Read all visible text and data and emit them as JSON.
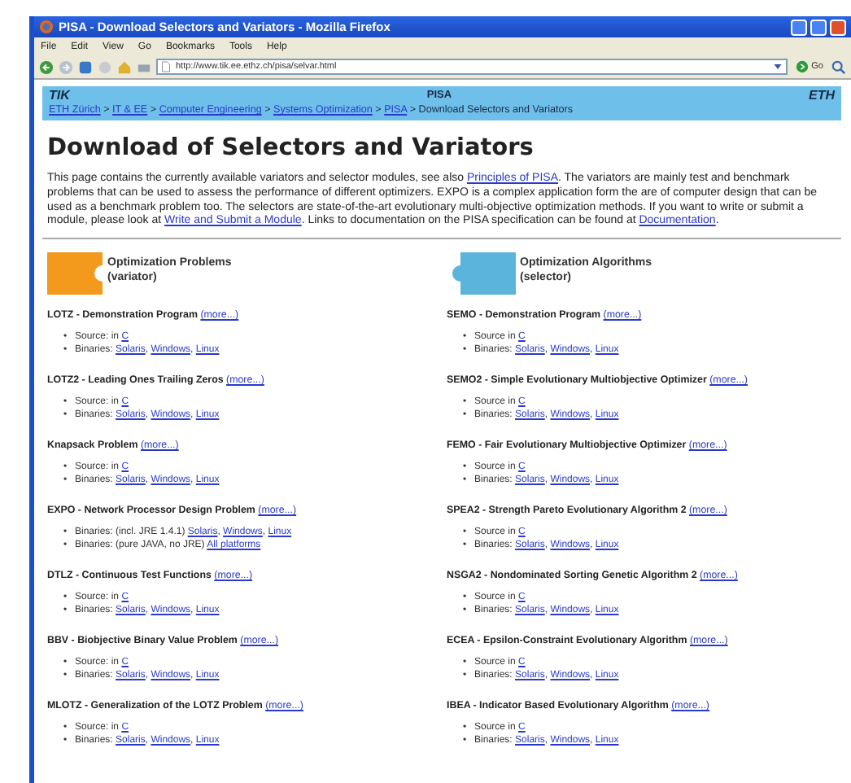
{
  "window": {
    "title": "PISA - Download Selectors and Variators - Mozilla Firefox"
  },
  "menu": [
    "File",
    "Edit",
    "View",
    "Go",
    "Bookmarks",
    "Tools",
    "Help"
  ],
  "toolbar": {
    "url": "http://www.tik.ee.ethz.ch/pisa/selvar.html",
    "go": "Go"
  },
  "site_header": {
    "left_logo": "TIK",
    "title": "PISA",
    "right_logo": "ETH"
  },
  "breadcrumb": [
    {
      "kind": "link",
      "text": "ETH Zürich"
    },
    {
      "kind": "text",
      "text": " > "
    },
    {
      "kind": "link",
      "text": "IT & EE"
    },
    {
      "kind": "text",
      "text": " > "
    },
    {
      "kind": "link",
      "text": "Computer Engineering"
    },
    {
      "kind": "text",
      "text": " > "
    },
    {
      "kind": "link",
      "text": "Systems Optimization"
    },
    {
      "kind": "text",
      "text": " > "
    },
    {
      "kind": "link",
      "text": "PISA"
    },
    {
      "kind": "text",
      "text": " > Download Selectors and Variators"
    }
  ],
  "heading": "Download of Selectors and Variators",
  "intro": [
    {
      "kind": "text",
      "text": "This page contains the currently available variators and selector modules, see also "
    },
    {
      "kind": "link",
      "text": "Principles of PISA"
    },
    {
      "kind": "text",
      "text": ". The variators are mainly test and benchmark problems that can be used to assess the performance of different optimizers. EXPO is a complex application form the are of computer design that can be used as a benchmark problem too. The selectors are state-of-the-art evolutionary multi-objective optimization methods. If you want to write or submit a module, please look at "
    },
    {
      "kind": "link",
      "text": "Write and Submit a Module"
    },
    {
      "kind": "text",
      "text": ". Links to documentation on the PISA specification can be found at "
    },
    {
      "kind": "link",
      "text": "Documentation"
    },
    {
      "kind": "text",
      "text": "."
    }
  ],
  "columns": [
    {
      "kind": "variator",
      "title": "Optimization Problems",
      "subtitle": "(variator)",
      "entries": [
        {
          "name": "LOTZ - Demonstration Program",
          "more": "(more...)",
          "lines": [
            [
              {
                "kind": "bullet",
                "text": "•"
              },
              {
                "kind": "text",
                "text": "Source: in "
              },
              {
                "kind": "link",
                "text": "C"
              }
            ],
            [
              {
                "kind": "bullet",
                "text": "•"
              },
              {
                "kind": "text",
                "text": "Binaries: "
              },
              {
                "kind": "link",
                "text": "Solaris"
              },
              {
                "kind": "text",
                "text": ", "
              },
              {
                "kind": "link",
                "text": "Windows"
              },
              {
                "kind": "text",
                "text": ", "
              },
              {
                "kind": "link",
                "text": "Linux"
              }
            ]
          ]
        },
        {
          "name": "LOTZ2 - Leading Ones Trailing Zeros",
          "more": "(more...)",
          "lines": [
            [
              {
                "kind": "bullet",
                "text": "•"
              },
              {
                "kind": "text",
                "text": "Source: in "
              },
              {
                "kind": "link",
                "text": "C"
              }
            ],
            [
              {
                "kind": "bullet",
                "text": "•"
              },
              {
                "kind": "text",
                "text": "Binaries: "
              },
              {
                "kind": "link",
                "text": "Solaris"
              },
              {
                "kind": "text",
                "text": ", "
              },
              {
                "kind": "link",
                "text": "Windows"
              },
              {
                "kind": "text",
                "text": ", "
              },
              {
                "kind": "link",
                "text": "Linux"
              }
            ]
          ]
        },
        {
          "name": "Knapsack Problem",
          "more": "(more...)",
          "lines": [
            [
              {
                "kind": "bullet",
                "text": "•"
              },
              {
                "kind": "text",
                "text": "Source: in "
              },
              {
                "kind": "link",
                "text": "C"
              }
            ],
            [
              {
                "kind": "bullet",
                "text": "•"
              },
              {
                "kind": "text",
                "text": "Binaries: "
              },
              {
                "kind": "link",
                "text": "Solaris"
              },
              {
                "kind": "text",
                "text": ", "
              },
              {
                "kind": "link",
                "text": "Windows"
              },
              {
                "kind": "text",
                "text": ", "
              },
              {
                "kind": "link",
                "text": "Linux"
              }
            ]
          ]
        },
        {
          "name": "EXPO - Network Processor Design Problem",
          "more": "(more...)",
          "lines": [
            [
              {
                "kind": "bullet",
                "text": "•"
              },
              {
                "kind": "text",
                "text": "Binaries: (incl. JRE 1.4.1) "
              },
              {
                "kind": "link",
                "text": "Solaris"
              },
              {
                "kind": "text",
                "text": ", "
              },
              {
                "kind": "link",
                "text": "Windows"
              },
              {
                "kind": "text",
                "text": ", "
              },
              {
                "kind": "link",
                "text": "Linux"
              }
            ],
            [
              {
                "kind": "bullet",
                "text": "•"
              },
              {
                "kind": "text",
                "text": "Binaries: (pure JAVA, no JRE) "
              },
              {
                "kind": "link",
                "text": "All platforms"
              }
            ]
          ]
        },
        {
          "name": "DTLZ - Continuous Test Functions",
          "more": "(more...)",
          "lines": [
            [
              {
                "kind": "bullet",
                "text": "•"
              },
              {
                "kind": "text",
                "text": "Source: in "
              },
              {
                "kind": "link",
                "text": "C"
              }
            ],
            [
              {
                "kind": "bullet",
                "text": "•"
              },
              {
                "kind": "text",
                "text": "Binaries: "
              },
              {
                "kind": "link",
                "text": "Solaris"
              },
              {
                "kind": "text",
                "text": ", "
              },
              {
                "kind": "link",
                "text": "Windows"
              },
              {
                "kind": "text",
                "text": ", "
              },
              {
                "kind": "link",
                "text": "Linux"
              }
            ]
          ]
        },
        {
          "name": "BBV - Biobjective Binary Value Problem",
          "more": "(more...)",
          "lines": [
            [
              {
                "kind": "bullet",
                "text": "•"
              },
              {
                "kind": "text",
                "text": "Source: in "
              },
              {
                "kind": "link",
                "text": "C"
              }
            ],
            [
              {
                "kind": "bullet",
                "text": "•"
              },
              {
                "kind": "text",
                "text": "Binaries: "
              },
              {
                "kind": "link",
                "text": "Solaris"
              },
              {
                "kind": "text",
                "text": ", "
              },
              {
                "kind": "link",
                "text": "Windows"
              },
              {
                "kind": "text",
                "text": ", "
              },
              {
                "kind": "link",
                "text": "Linux"
              }
            ]
          ]
        },
        {
          "name": "MLOTZ - Generalization of the LOTZ Problem",
          "more": "(more...)",
          "lines": [
            [
              {
                "kind": "bullet",
                "text": "•"
              },
              {
                "kind": "text",
                "text": "Source: in "
              },
              {
                "kind": "link",
                "text": "C"
              }
            ],
            [
              {
                "kind": "bullet",
                "text": "•"
              },
              {
                "kind": "text",
                "text": "Binaries: "
              },
              {
                "kind": "link",
                "text": "Solaris"
              },
              {
                "kind": "text",
                "text": ", "
              },
              {
                "kind": "link",
                "text": "Windows"
              },
              {
                "kind": "text",
                "text": ", "
              },
              {
                "kind": "link",
                "text": "Linux"
              }
            ]
          ]
        }
      ]
    },
    {
      "kind": "selector",
      "title": "Optimization Algorithms",
      "subtitle": "(selector)",
      "entries": [
        {
          "name": "SEMO - Demonstration Program",
          "more": "(more...)",
          "lines": [
            [
              {
                "kind": "bullet",
                "text": "•"
              },
              {
                "kind": "text",
                "text": "Source in "
              },
              {
                "kind": "link",
                "text": "C"
              }
            ],
            [
              {
                "kind": "bullet",
                "text": "•"
              },
              {
                "kind": "text",
                "text": "Binaries: "
              },
              {
                "kind": "link",
                "text": "Solaris"
              },
              {
                "kind": "text",
                "text": ", "
              },
              {
                "kind": "link",
                "text": "Windows"
              },
              {
                "kind": "text",
                "text": ", "
              },
              {
                "kind": "link",
                "text": "Linux"
              }
            ]
          ]
        },
        {
          "name": "SEMO2 - Simple Evolutionary Multiobjective Optimizer",
          "more": "(more...)",
          "lines": [
            [
              {
                "kind": "bullet",
                "text": "•"
              },
              {
                "kind": "text",
                "text": "Source in "
              },
              {
                "kind": "link",
                "text": "C"
              }
            ],
            [
              {
                "kind": "bullet",
                "text": "•"
              },
              {
                "kind": "text",
                "text": "Binaries: "
              },
              {
                "kind": "link",
                "text": "Solaris"
              },
              {
                "kind": "text",
                "text": ", "
              },
              {
                "kind": "link",
                "text": "Windows"
              },
              {
                "kind": "text",
                "text": ", "
              },
              {
                "kind": "link",
                "text": "Linux"
              }
            ]
          ]
        },
        {
          "name": "FEMO - Fair Evolutionary Multiobjective Optimizer",
          "more": "(more...)",
          "lines": [
            [
              {
                "kind": "bullet",
                "text": "•"
              },
              {
                "kind": "text",
                "text": "Source in "
              },
              {
                "kind": "link",
                "text": "C"
              }
            ],
            [
              {
                "kind": "bullet",
                "text": "•"
              },
              {
                "kind": "text",
                "text": "Binaries: "
              },
              {
                "kind": "link",
                "text": "Solaris"
              },
              {
                "kind": "text",
                "text": ", "
              },
              {
                "kind": "link",
                "text": "Windows"
              },
              {
                "kind": "text",
                "text": ", "
              },
              {
                "kind": "link",
                "text": "Linux"
              }
            ]
          ]
        },
        {
          "name": "SPEA2 - Strength Pareto Evolutionary Algorithm 2",
          "more": "(more...)",
          "lines": [
            [
              {
                "kind": "bullet",
                "text": "•"
              },
              {
                "kind": "text",
                "text": "Source in "
              },
              {
                "kind": "link",
                "text": "C"
              }
            ],
            [
              {
                "kind": "bullet",
                "text": "•"
              },
              {
                "kind": "text",
                "text": "Binaries: "
              },
              {
                "kind": "link",
                "text": "Solaris"
              },
              {
                "kind": "text",
                "text": ", "
              },
              {
                "kind": "link",
                "text": "Windows"
              },
              {
                "kind": "text",
                "text": ", "
              },
              {
                "kind": "link",
                "text": "Linux"
              }
            ]
          ]
        },
        {
          "name": "NSGA2 - Nondominated Sorting Genetic Algorithm 2",
          "more": "(more...)",
          "lines": [
            [
              {
                "kind": "bullet",
                "text": "•"
              },
              {
                "kind": "text",
                "text": "Source in "
              },
              {
                "kind": "link",
                "text": "C"
              }
            ],
            [
              {
                "kind": "bullet",
                "text": "•"
              },
              {
                "kind": "text",
                "text": "Binaries: "
              },
              {
                "kind": "link",
                "text": "Solaris"
              },
              {
                "kind": "text",
                "text": ", "
              },
              {
                "kind": "link",
                "text": "Windows"
              },
              {
                "kind": "text",
                "text": ", "
              },
              {
                "kind": "link",
                "text": "Linux"
              }
            ]
          ]
        },
        {
          "name": "ECEA - Epsilon-Constraint Evolutionary Algorithm",
          "more": "(more...)",
          "lines": [
            [
              {
                "kind": "bullet",
                "text": "•"
              },
              {
                "kind": "text",
                "text": "Source in "
              },
              {
                "kind": "link",
                "text": "C"
              }
            ],
            [
              {
                "kind": "bullet",
                "text": "•"
              },
              {
                "kind": "text",
                "text": "Binaries: "
              },
              {
                "kind": "link",
                "text": "Solaris"
              },
              {
                "kind": "text",
                "text": ", "
              },
              {
                "kind": "link",
                "text": "Windows"
              },
              {
                "kind": "text",
                "text": ", "
              },
              {
                "kind": "link",
                "text": "Linux"
              }
            ]
          ]
        },
        {
          "name": "IBEA - Indicator Based Evolutionary Algorithm",
          "more": "(more...)",
          "lines": [
            [
              {
                "kind": "bullet",
                "text": "•"
              },
              {
                "kind": "text",
                "text": "Source in "
              },
              {
                "kind": "link",
                "text": "C"
              }
            ],
            [
              {
                "kind": "bullet",
                "text": "•"
              },
              {
                "kind": "text",
                "text": "Binaries: "
              },
              {
                "kind": "link",
                "text": "Solaris"
              },
              {
                "kind": "text",
                "text": ", "
              },
              {
                "kind": "link",
                "text": "Windows"
              },
              {
                "kind": "text",
                "text": ", "
              },
              {
                "kind": "link",
                "text": "Linux"
              }
            ]
          ]
        }
      ]
    }
  ]
}
